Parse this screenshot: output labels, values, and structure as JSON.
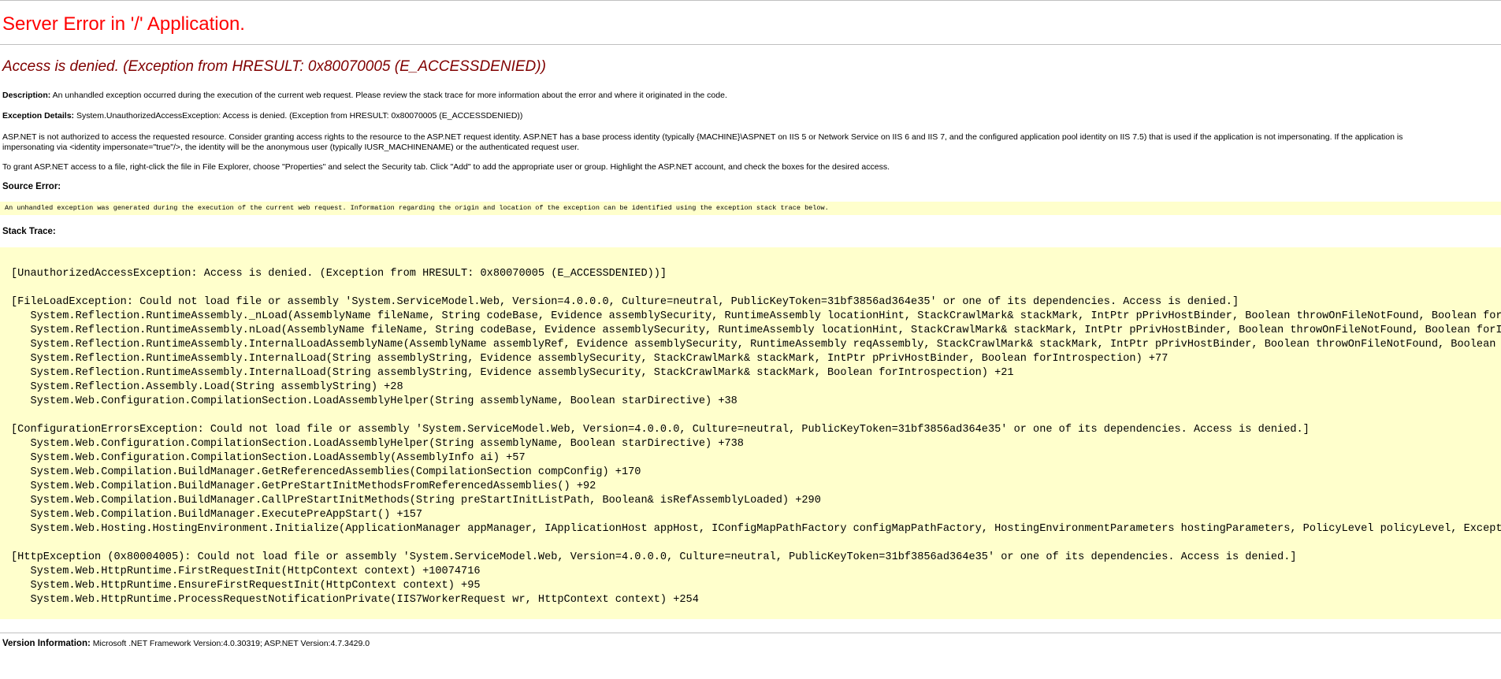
{
  "page": {
    "title": "Server Error in '/' Application.",
    "error_heading": "Access is denied. (Exception from HRESULT: 0x80070005 (E_ACCESSDENIED))",
    "description_label": "Description:",
    "description_text": "An unhandled exception occurred during the execution of the current web request. Please review the stack trace for more information about the error and where it originated in the code.",
    "exception_details_label": "Exception Details:",
    "exception_details_text": "System.UnauthorizedAccessException: Access is denied. (Exception from HRESULT: 0x80070005 (E_ACCESSDENIED))",
    "explanation_lines": [
      "ASP.NET is not authorized to access the requested resource. Consider granting access rights to the resource to the ASP.NET request identity. ASP.NET has a base process identity (typically {MACHINE}\\ASPNET on IIS 5 or Network Service on IIS 6 and IIS 7, and the configured application pool identity on IIS 7.5) that is used if the application is not impersonating. If the application is",
      "impersonating via <identity impersonate=\"true\"/>, the identity will be the anonymous user (typically IUSR_MACHINENAME) or the authenticated request user."
    ],
    "grant_access_text": "To grant ASP.NET access to a file, right-click the file in File Explorer, choose \"Properties\" and select the Security tab. Click \"Add\" to add the appropriate user or group. Highlight the ASP.NET account, and check the boxes for the desired access.",
    "source_error_label": "Source Error:",
    "source_error_text": "An unhandled exception was generated during the execution of the current web request. Information regarding the origin and location of the exception can be identified using the exception stack trace below.",
    "stack_trace_label": "Stack Trace:",
    "stack_trace": [
      "[UnauthorizedAccessException: Access is denied. (Exception from HRESULT: 0x80070005 (E_ACCESSDENIED))]",
      "",
      "[FileLoadException: Could not load file or assembly 'System.ServiceModel.Web, Version=4.0.0.0, Culture=neutral, PublicKeyToken=31bf3856ad364e35' or one of its dependencies. Access is denied.]",
      "   System.Reflection.RuntimeAssembly._nLoad(AssemblyName fileName, String codeBase, Evidence assemblySecurity, RuntimeAssembly locationHint, StackCrawlMark& stackMark, IntPtr pPrivHostBinder, Boolean throwOnFileNotFound, Boolean forInt",
      "   System.Reflection.RuntimeAssembly.nLoad(AssemblyName fileName, String codeBase, Evidence assemblySecurity, RuntimeAssembly locationHint, StackCrawlMark& stackMark, IntPtr pPrivHostBinder, Boolean throwOnFileNotFound, Boolean forIntr",
      "   System.Reflection.RuntimeAssembly.InternalLoadAssemblyName(AssemblyName assemblyRef, Evidence assemblySecurity, RuntimeAssembly reqAssembly, StackCrawlMark& stackMark, IntPtr pPrivHostBinder, Boolean throwOnFileNotFound, Boolean for",
      "   System.Reflection.RuntimeAssembly.InternalLoad(String assemblyString, Evidence assemblySecurity, StackCrawlMark& stackMark, IntPtr pPrivHostBinder, Boolean forIntrospection) +77",
      "   System.Reflection.RuntimeAssembly.InternalLoad(String assemblyString, Evidence assemblySecurity, StackCrawlMark& stackMark, Boolean forIntrospection) +21",
      "   System.Reflection.Assembly.Load(String assemblyString) +28",
      "   System.Web.Configuration.CompilationSection.LoadAssemblyHelper(String assemblyName, Boolean starDirective) +38",
      "",
      "[ConfigurationErrorsException: Could not load file or assembly 'System.ServiceModel.Web, Version=4.0.0.0, Culture=neutral, PublicKeyToken=31bf3856ad364e35' or one of its dependencies. Access is denied.]",
      "   System.Web.Configuration.CompilationSection.LoadAssemblyHelper(String assemblyName, Boolean starDirective) +738",
      "   System.Web.Configuration.CompilationSection.LoadAssembly(AssemblyInfo ai) +57",
      "   System.Web.Compilation.BuildManager.GetReferencedAssemblies(CompilationSection compConfig) +170",
      "   System.Web.Compilation.BuildManager.GetPreStartInitMethodsFromReferencedAssemblies() +92",
      "   System.Web.Compilation.BuildManager.CallPreStartInitMethods(String preStartInitListPath, Boolean& isRefAssemblyLoaded) +290",
      "   System.Web.Compilation.BuildManager.ExecutePreAppStart() +157",
      "   System.Web.Hosting.HostingEnvironment.Initialize(ApplicationManager appManager, IApplicationHost appHost, IConfigMapPathFactory configMapPathFactory, HostingEnvironmentParameters hostingParameters, PolicyLevel policyLevel, Exception",
      "",
      "[HttpException (0x80004005): Could not load file or assembly 'System.ServiceModel.Web, Version=4.0.0.0, Culture=neutral, PublicKeyToken=31bf3856ad364e35' or one of its dependencies. Access is denied.]",
      "   System.Web.HttpRuntime.FirstRequestInit(HttpContext context) +10074716",
      "   System.Web.HttpRuntime.EnsureFirstRequestInit(HttpContext context) +95",
      "   System.Web.HttpRuntime.ProcessRequestNotificationPrivate(IIS7WorkerRequest wr, HttpContext context) +254"
    ],
    "version_label": "Version Information:",
    "version_text": "Microsoft .NET Framework Version:4.0.30319; ASP.NET Version:4.7.3429.0"
  },
  "colors": {
    "title": "#ff0000",
    "heading": "#800000",
    "code_background": "#ffffcc",
    "rule": "#c0c0c0"
  }
}
